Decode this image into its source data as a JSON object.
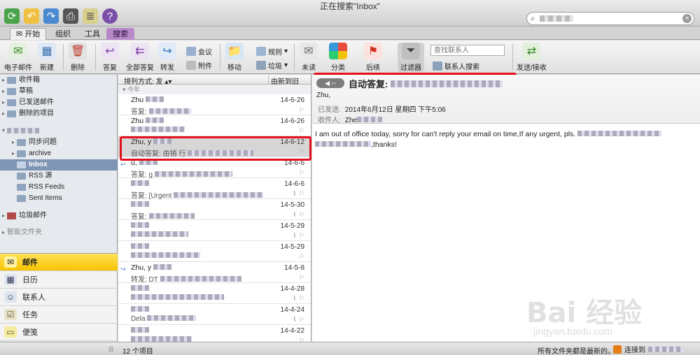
{
  "window": {
    "title": "正在搜索\"Inbox\""
  },
  "ribbon_tabs": [
    "开始",
    "组织",
    "工具",
    "搜索"
  ],
  "ribbon": {
    "new_email": "电子邮件",
    "new": "新建",
    "delete": "删除",
    "reply": "答复",
    "reply_all": "全部答复",
    "forward": "转发",
    "meeting": "会议",
    "attachment": "附件",
    "move": "移动",
    "rules": "规则",
    "junk": "垃圾",
    "unread": "未读",
    "categorize": "分类",
    "follow_up": "后续",
    "filter": "过滤器",
    "contact_search_placeholder": "查找联系人",
    "contact_search_button": "联系人搜索",
    "send_receive": "发送/接收"
  },
  "folders": [
    {
      "label": "收件箱",
      "indent": 0
    },
    {
      "label": "草稿",
      "indent": 0
    },
    {
      "label": "已发送邮件",
      "indent": 0
    },
    {
      "label": "删除的项目",
      "indent": 0
    },
    {
      "label": "同步问题",
      "indent": 1
    },
    {
      "label": "archive",
      "indent": 1
    },
    {
      "label": "Inbox",
      "indent": 1,
      "selected": true
    },
    {
      "label": "RSS 源",
      "indent": 1
    },
    {
      "label": "RSS Feeds",
      "indent": 1
    },
    {
      "label": "Sent Items",
      "indent": 1
    },
    {
      "label": "垃圾邮件",
      "indent": 0
    },
    {
      "label": "智能文件夹",
      "indent": 0
    }
  ],
  "nav": [
    "邮件",
    "日历",
    "联系人",
    "任务",
    "便笺"
  ],
  "list": {
    "sort_label": "排列方式: 发",
    "order_label": "由新到旧",
    "today_group": "今年",
    "messages": [
      {
        "from": "Zhu",
        "date": "14-6-26",
        "subject": "答复: ",
        "icon": "",
        "clip": false
      },
      {
        "from": "Zhu",
        "date": "14-6-26",
        "subject": "",
        "icon": "",
        "clip": false
      },
      {
        "from": "Zhu, y",
        "date": "14-6-12",
        "subject": "自动答复: 由销 行",
        "icon": "",
        "clip": false,
        "selected": true
      },
      {
        "from": "u,",
        "date": "14-6-6",
        "subject": "答复: g",
        "icon": "↩",
        "clip": false
      },
      {
        "from": "",
        "date": "14-6-6",
        "subject": "答复: [Urgent",
        "icon": "",
        "clip": true
      },
      {
        "from": "",
        "date": "14-5-30",
        "subject": "答复:",
        "icon": "",
        "clip": true
      },
      {
        "from": "",
        "date": "14-5-29",
        "subject": "",
        "icon": "",
        "clip": true
      },
      {
        "from": "",
        "date": "14-5-29",
        "subject": "",
        "icon": "",
        "clip": false
      },
      {
        "from": "Zhu, y",
        "date": "14-5-8",
        "subject": "转发: DT",
        "icon": "↪",
        "clip": false
      },
      {
        "from": "",
        "date": "14-4-28",
        "subject": "",
        "icon": "",
        "clip": true
      },
      {
        "from": "",
        "date": "14-4-24",
        "subject": "Dela",
        "icon": "",
        "clip": true
      },
      {
        "from": "",
        "date": "14-4-22",
        "subject": "",
        "icon": "",
        "clip": false
      }
    ]
  },
  "reading": {
    "subject": "自动答复:",
    "from": "Zhu,",
    "sent_label": "已发送:",
    "sent_value": "2014年6月12日 星期四 下午5:06",
    "to_label": "收件人:",
    "to_value": "Zhe",
    "body_line1": "I am out of office today, sorry for can't reply your email on time,If any urgent, pls.",
    "body_line2": ",thanks!"
  },
  "status": {
    "count": "12 个项目",
    "updated": "所有文件夹都是最新的。",
    "connection": "连接到"
  },
  "watermark": {
    "brand": "Bai 经验",
    "url": "jingyan.baidu.com"
  }
}
